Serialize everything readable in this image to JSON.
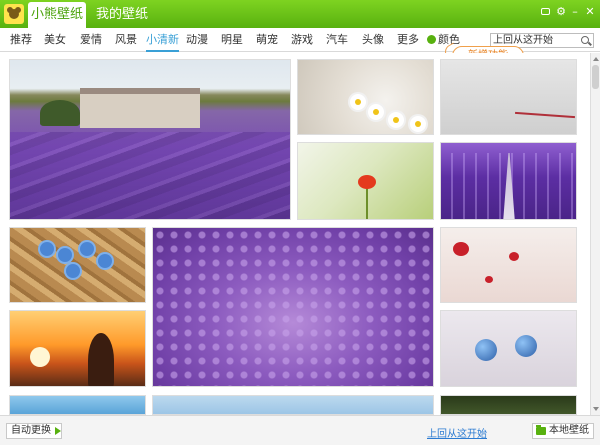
{
  "app": {
    "title_tab": "小熊壁纸",
    "my_tab": "我的壁纸"
  },
  "window_controls": [
    "message-icon",
    "gear-icon",
    "minimize-icon",
    "close-icon"
  ],
  "nav": {
    "items": [
      "推荐",
      "美女",
      "爱情",
      "风景",
      "小清新",
      "动漫",
      "明星",
      "萌宠",
      "游戏",
      "汽车",
      "头像",
      "更多"
    ],
    "active": "小清新",
    "color_label": "颜色"
  },
  "search": {
    "value": "上回从这开始"
  },
  "tip": {
    "text": "新增功能"
  },
  "gallery": {
    "thumbnails": [
      "lavender-field-house",
      "white-daisies-glass",
      "pencil-on-paper",
      "red-poppy-grass",
      "purple-lavender-rows",
      "blue-flowers-wood",
      "lavender-closeup",
      "red-poppies-pink",
      "girl-sunset-silhouette",
      "blue-ladybug-toys",
      "people-sky",
      "blue-sky",
      "dark-forest"
    ]
  },
  "statusbar": {
    "auto_change": "自动更换",
    "back_link": "上回从这开始",
    "local_wallpaper": "本地壁纸"
  },
  "colors": {
    "brand_green": "#58b10f",
    "active_tab_blue": "#3aa0d6",
    "tip_orange": "#e67d19"
  }
}
